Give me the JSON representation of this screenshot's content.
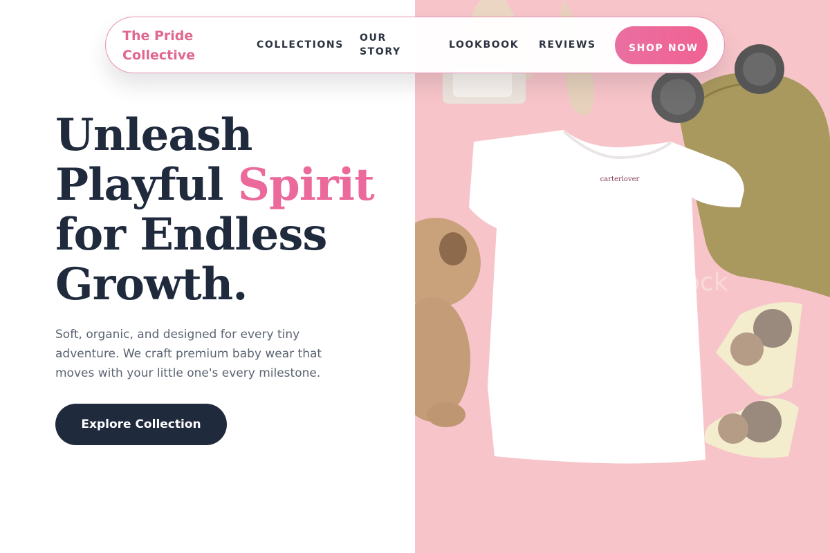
{
  "nav": {
    "brand": "The Pride Collective",
    "links": [
      "COLLECTIONS",
      "OUR STORY",
      "LOOKBOOK",
      "REVIEWS"
    ],
    "cta_label": "SHOP NOW"
  },
  "hero": {
    "title_line1": "Unleash",
    "title_line2a": "Playful ",
    "title_line2b": "Spirit",
    "title_line3": "for Endless",
    "title_line4": "Growth.",
    "description": "Soft, organic, and designed for every tiny adventure. We craft premium baby wear that moves with your little one's every milestone.",
    "button_label": "Explore Collection"
  },
  "photo": {
    "tshirt_tag": "carterlover",
    "watermark": "shutterstock"
  },
  "colors": {
    "accent": "#eb6a9b",
    "navy": "#1f2a3d",
    "photo_background": "#f6c4c8"
  }
}
